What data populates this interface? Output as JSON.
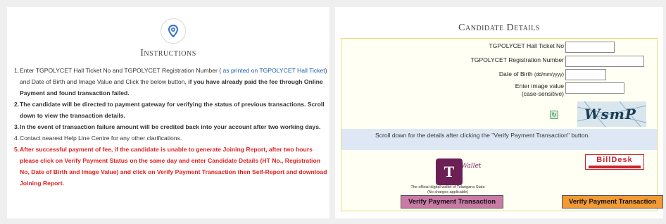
{
  "instructions": {
    "title": "Instructions",
    "items": [
      {
        "num": "1.",
        "pre": "Enter TGPOLYCET Hall Ticket No and TGPOLYCET Registration Number ( ",
        "link": "as printed on TGPOLYCET Hall Ticket",
        "mid": ") and Date of Birth and Image Value and Click the below button, ",
        "bold": "if you have already paid the fee through Online Payment and found transaction failed."
      },
      {
        "num": "2.",
        "text": "The candidate will be directed to payment gateway for verifying the status of previous transactions. Scroll down to view the transaction details."
      },
      {
        "num": "3.",
        "text": "In the event of transaction failure amount will be credited back into your account after two working days."
      },
      {
        "num": "4.",
        "text": "Contact nearest Help Line Centre for any other clarifications."
      },
      {
        "num": "5.",
        "text": "After successful payment of fee, if the candidate is unable to generate Joining Report, after two hours please click on Verify Payment Status on the same day and enter Candidate Details (HT No., Registration No, Date of Birth and Image Value) and click on Verify Payment Transaction then Self-Report and download Joining Report."
      }
    ]
  },
  "candidate": {
    "title": "Candidate Details",
    "hall_ticket_label": "TGPOLYCET Hall Ticket No",
    "hall_ticket_value": "",
    "registration_label": "TGPOLYCET Registration Number",
    "registration_value": "",
    "dob_label": "Date of Birth",
    "dob_format": "(dd/mm/yyyy)",
    "dob_value": "",
    "image_label": "Enter image value",
    "image_sub": "(case-sensitive)",
    "image_value": "",
    "captcha_text": "WsmP"
  },
  "scroll_note": "Scroll down for the details after clicking the \"Verify Payment Transaction\" button.",
  "twallet": {
    "logo_letter": "T",
    "logo_word": "Wallet",
    "caption_line1": "The official digital wallet of Telangana State",
    "caption_line2": "(No charges applicable)",
    "button_label": "Verify Payment Transaction"
  },
  "billdesk": {
    "logo_text": "BillDesk",
    "button_label": "Verify Payment Transaction"
  },
  "colors": {
    "accent_blue": "#1d5fb4",
    "warning_red": "#e02020",
    "twallet_purple": "#c97ba6",
    "billdesk_orange": "#f29a33"
  }
}
